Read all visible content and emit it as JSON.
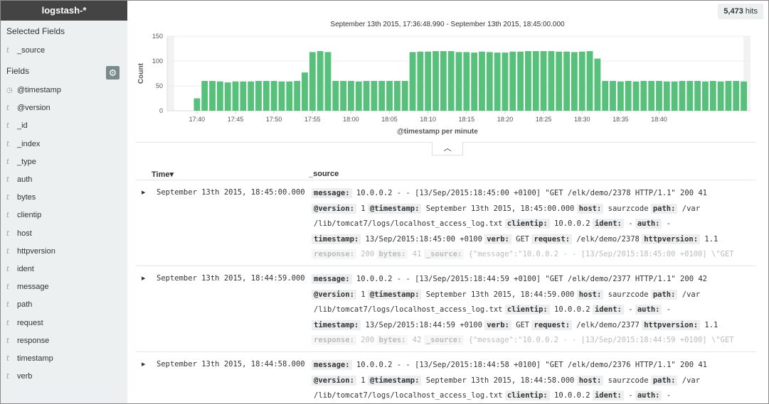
{
  "sidebar": {
    "index_pattern": "logstash-*",
    "selected_fields_heading": "Selected Fields",
    "selected_fields": [
      {
        "type": "t",
        "name": "_source"
      }
    ],
    "fields_heading": "Fields",
    "fields": [
      {
        "type": "clock",
        "name": "@timestamp"
      },
      {
        "type": "t",
        "name": "@version"
      },
      {
        "type": "t",
        "name": "_id"
      },
      {
        "type": "t",
        "name": "_index"
      },
      {
        "type": "t",
        "name": "_type"
      },
      {
        "type": "t",
        "name": "auth"
      },
      {
        "type": "t",
        "name": "bytes"
      },
      {
        "type": "t",
        "name": "clientip"
      },
      {
        "type": "t",
        "name": "host"
      },
      {
        "type": "t",
        "name": "httpversion"
      },
      {
        "type": "t",
        "name": "ident"
      },
      {
        "type": "t",
        "name": "message"
      },
      {
        "type": "t",
        "name": "path"
      },
      {
        "type": "t",
        "name": "request"
      },
      {
        "type": "t",
        "name": "response"
      },
      {
        "type": "t",
        "name": "timestamp"
      },
      {
        "type": "t",
        "name": "verb"
      }
    ]
  },
  "hits": {
    "count": "5,473",
    "label": "hits"
  },
  "chart_data": {
    "type": "bar",
    "title": "September 13th 2015, 17:36:48.990 - September 13th 2015, 18:45:00.000",
    "xlabel": "@timestamp per minute",
    "ylabel": "Count",
    "ylim": [
      0,
      150
    ],
    "yticks": [
      0,
      50,
      100,
      150
    ],
    "x_tick_labels": [
      "17:40",
      "17:45",
      "17:50",
      "17:55",
      "18:00",
      "18:05",
      "18:10",
      "18:15",
      "18:20",
      "18:25",
      "18:30",
      "18:35",
      "18:40"
    ],
    "x_start_minute": 37,
    "values": [
      0,
      0,
      0,
      25,
      60,
      60,
      59,
      57,
      59,
      59,
      59,
      60,
      60,
      60,
      59,
      59,
      60,
      77,
      118,
      120,
      118,
      60,
      60,
      60,
      59,
      60,
      60,
      60,
      60,
      60,
      60,
      118,
      119,
      119,
      120,
      120,
      120,
      118,
      118,
      117,
      119,
      118,
      117,
      117,
      119,
      119,
      120,
      120,
      120,
      120,
      119,
      119,
      118,
      119,
      120,
      105,
      60,
      60,
      59,
      60,
      59,
      60,
      60,
      60,
      59,
      59,
      60,
      60,
      60,
      59,
      60,
      59,
      60,
      60,
      59
    ],
    "bar_color": "#57c17b",
    "grid": true
  },
  "table": {
    "col_time": "Time",
    "col_source": "_source",
    "sort_indicator": "▾",
    "rows": [
      {
        "time": "September 13th 2015, 18:45:00.000",
        "lines": [
          [
            {
              "t": "message:",
              "k": true
            },
            {
              "t": " 10.0.0.2 - - [13/Sep/2015:18:45:00 +0100] \"GET /elk/demo/2378 HTTP/1.1\" 200 41"
            }
          ],
          [
            {
              "t": "@version:",
              "k": true
            },
            {
              "t": " 1 "
            },
            {
              "t": "@timestamp:",
              "k": true
            },
            {
              "t": " September 13th 2015, 18:45:00.000 "
            },
            {
              "t": "host:",
              "k": true
            },
            {
              "t": " saurzcode "
            },
            {
              "t": "path:",
              "k": true
            },
            {
              "t": " /var"
            }
          ],
          [
            {
              "t": "/lib/tomcat7/logs/localhost_access_log.txt "
            },
            {
              "t": "clientip:",
              "k": true
            },
            {
              "t": " 10.0.0.2 "
            },
            {
              "t": "ident:",
              "k": true
            },
            {
              "t": " - "
            },
            {
              "t": "auth:",
              "k": true
            },
            {
              "t": " -"
            }
          ],
          [
            {
              "t": "timestamp:",
              "k": true
            },
            {
              "t": " 13/Sep/2015:18:45:00 +0100 "
            },
            {
              "t": "verb:",
              "k": true
            },
            {
              "t": " GET "
            },
            {
              "t": "request:",
              "k": true
            },
            {
              "t": " /elk/demo/2378 "
            },
            {
              "t": "httpversion:",
              "k": true
            },
            {
              "t": " 1.1"
            }
          ],
          [
            {
              "t": "response:",
              "k": true
            },
            {
              "t": " 200 "
            },
            {
              "t": "bytes:",
              "k": true
            },
            {
              "t": " 41 "
            },
            {
              "t": "_source:",
              "k": true
            },
            {
              "t": " {\"message\":\"10.0.0.2 - - [13/Sep/2015:18:45:00 +0100] \\\"GET"
            }
          ]
        ]
      },
      {
        "time": "September 13th 2015, 18:44:59.000",
        "lines": [
          [
            {
              "t": "message:",
              "k": true
            },
            {
              "t": " 10.0.0.2 - - [13/Sep/2015:18:44:59 +0100] \"GET /elk/demo/2377 HTTP/1.1\" 200 42"
            }
          ],
          [
            {
              "t": "@version:",
              "k": true
            },
            {
              "t": " 1 "
            },
            {
              "t": "@timestamp:",
              "k": true
            },
            {
              "t": " September 13th 2015, 18:44:59.000 "
            },
            {
              "t": "host:",
              "k": true
            },
            {
              "t": " saurzcode "
            },
            {
              "t": "path:",
              "k": true
            },
            {
              "t": " /var"
            }
          ],
          [
            {
              "t": "/lib/tomcat7/logs/localhost_access_log.txt "
            },
            {
              "t": "clientip:",
              "k": true
            },
            {
              "t": " 10.0.0.2 "
            },
            {
              "t": "ident:",
              "k": true
            },
            {
              "t": " - "
            },
            {
              "t": "auth:",
              "k": true
            },
            {
              "t": " -"
            }
          ],
          [
            {
              "t": "timestamp:",
              "k": true
            },
            {
              "t": " 13/Sep/2015:18:44:59 +0100 "
            },
            {
              "t": "verb:",
              "k": true
            },
            {
              "t": " GET "
            },
            {
              "t": "request:",
              "k": true
            },
            {
              "t": " /elk/demo/2377 "
            },
            {
              "t": "httpversion:",
              "k": true
            },
            {
              "t": " 1.1"
            }
          ],
          [
            {
              "t": "response:",
              "k": true
            },
            {
              "t": " 200 "
            },
            {
              "t": "bytes:",
              "k": true
            },
            {
              "t": " 42 "
            },
            {
              "t": "_source:",
              "k": true
            },
            {
              "t": " {\"message\":\"10.0.0.2 - - [13/Sep/2015:18:44:59 +0100] \\\"GET"
            }
          ]
        ]
      },
      {
        "time": "September 13th 2015, 18:44:58.000",
        "lines": [
          [
            {
              "t": "message:",
              "k": true
            },
            {
              "t": " 10.0.0.2 - - [13/Sep/2015:18:44:58 +0100] \"GET /elk/demo/2376 HTTP/1.1\" 200 41"
            }
          ],
          [
            {
              "t": "@version:",
              "k": true
            },
            {
              "t": " 1 "
            },
            {
              "t": "@timestamp:",
              "k": true
            },
            {
              "t": " September 13th 2015, 18:44:58.000 "
            },
            {
              "t": "host:",
              "k": true
            },
            {
              "t": " saurzcode "
            },
            {
              "t": "path:",
              "k": true
            },
            {
              "t": " /var"
            }
          ],
          [
            {
              "t": "/lib/tomcat7/logs/localhost_access_log.txt "
            },
            {
              "t": "clientip:",
              "k": true
            },
            {
              "t": " 10.0.0.2 "
            },
            {
              "t": "ident:",
              "k": true
            },
            {
              "t": " - "
            },
            {
              "t": "auth:",
              "k": true
            },
            {
              "t": " -"
            }
          ]
        ]
      }
    ]
  }
}
